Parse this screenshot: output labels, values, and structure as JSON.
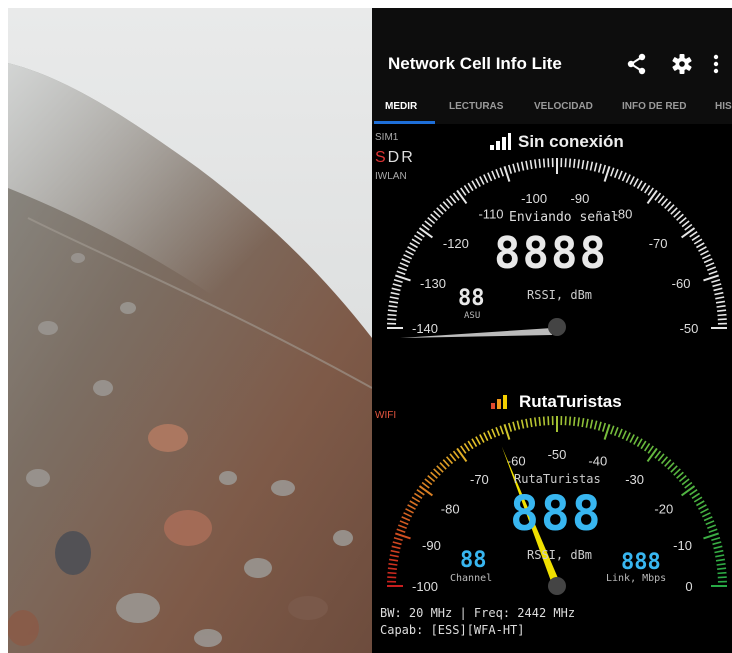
{
  "app": {
    "title": "Network Cell Info Lite",
    "icons": {
      "share": "share-icon",
      "settings": "gear-icon",
      "menu": "more-vert-icon"
    },
    "tabs": [
      {
        "label": "MEDIR",
        "active": true
      },
      {
        "label": "LECTURAS",
        "active": false
      },
      {
        "label": "VELOCIDAD",
        "active": false
      },
      {
        "label": "INFO DE RED",
        "active": false
      },
      {
        "label": "HIS",
        "active": false
      }
    ],
    "accent": "#1e6fd9"
  },
  "cell": {
    "sim_label": "SIM1",
    "sdr_s": "S",
    "sdr_rest": "DR",
    "iwlan_label": "IWLAN",
    "status": "Sin conexión",
    "gauge": {
      "ticks": [
        "-140",
        "-130",
        "-120",
        "-110",
        "-100",
        "-90",
        "-80",
        "-70",
        "-60",
        "-50"
      ],
      "sending": "Enviando señal",
      "big_value": "8888",
      "asu_value": "88",
      "asu_label": "ASU",
      "unit": "RSSI, dBm",
      "needle_value": -140
    }
  },
  "wifi": {
    "label": "WIFI",
    "ssid": "RutaTuristas",
    "ssid_color": "#f5d000",
    "gauge": {
      "ticks": [
        "-100",
        "-90",
        "-80",
        "-70",
        "-60",
        "-50",
        "-40",
        "-30",
        "-20",
        "-10",
        "0"
      ],
      "network_name": "RutaTuristas",
      "big_value": "888",
      "unit": "RSSI, dBm",
      "channel_value": "88",
      "channel_label": "Channel",
      "link_value": "888",
      "link_label": "Link, Mbps",
      "needle_value": -62
    },
    "bw_line": "BW: 20 MHz | Freq: 2442 MHz",
    "capab_line": "Capab: [ESS][WFA-HT]"
  }
}
